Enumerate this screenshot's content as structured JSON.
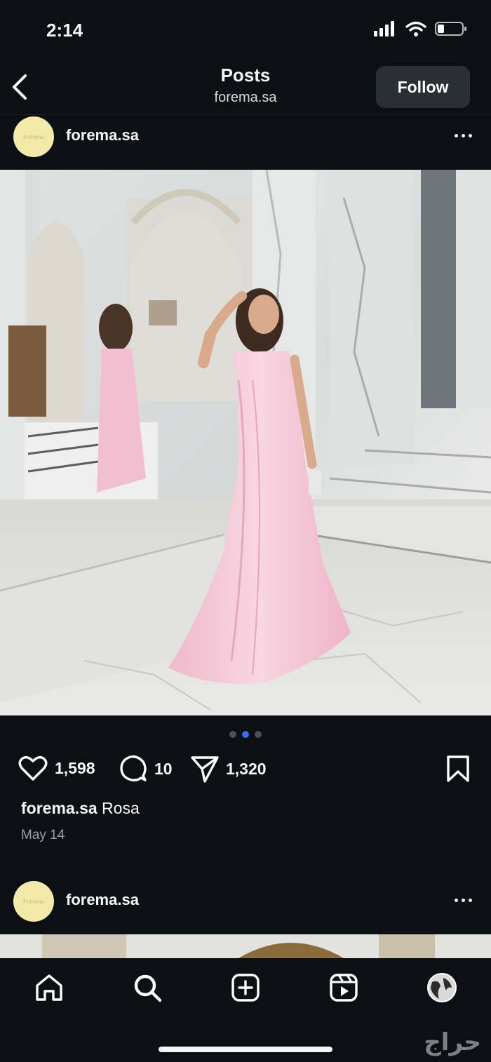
{
  "status": {
    "time": "2:14"
  },
  "header": {
    "title": "Posts",
    "subtitle": "forema.sa",
    "follow_label": "Follow"
  },
  "post": {
    "username": "forema.sa",
    "avatar_text": "Forema",
    "likes": "1,598",
    "comments": "10",
    "shares": "1,320",
    "caption_user": "forema.sa",
    "caption_text": " Rosa",
    "date": "May 14",
    "carousel": {
      "count": 3,
      "active": 2
    }
  },
  "next_post": {
    "username": "forema.sa",
    "avatar_text": "Forema"
  },
  "nav": {
    "items": [
      "home-icon",
      "search-icon",
      "create-icon",
      "reels-icon",
      "profile-icon"
    ]
  },
  "watermark": "حراج",
  "colors": {
    "background": "#0c0f14",
    "active_dot": "#3d6cf0",
    "follow_bg": "#2a2f36",
    "dress": "#f4c7d6"
  }
}
